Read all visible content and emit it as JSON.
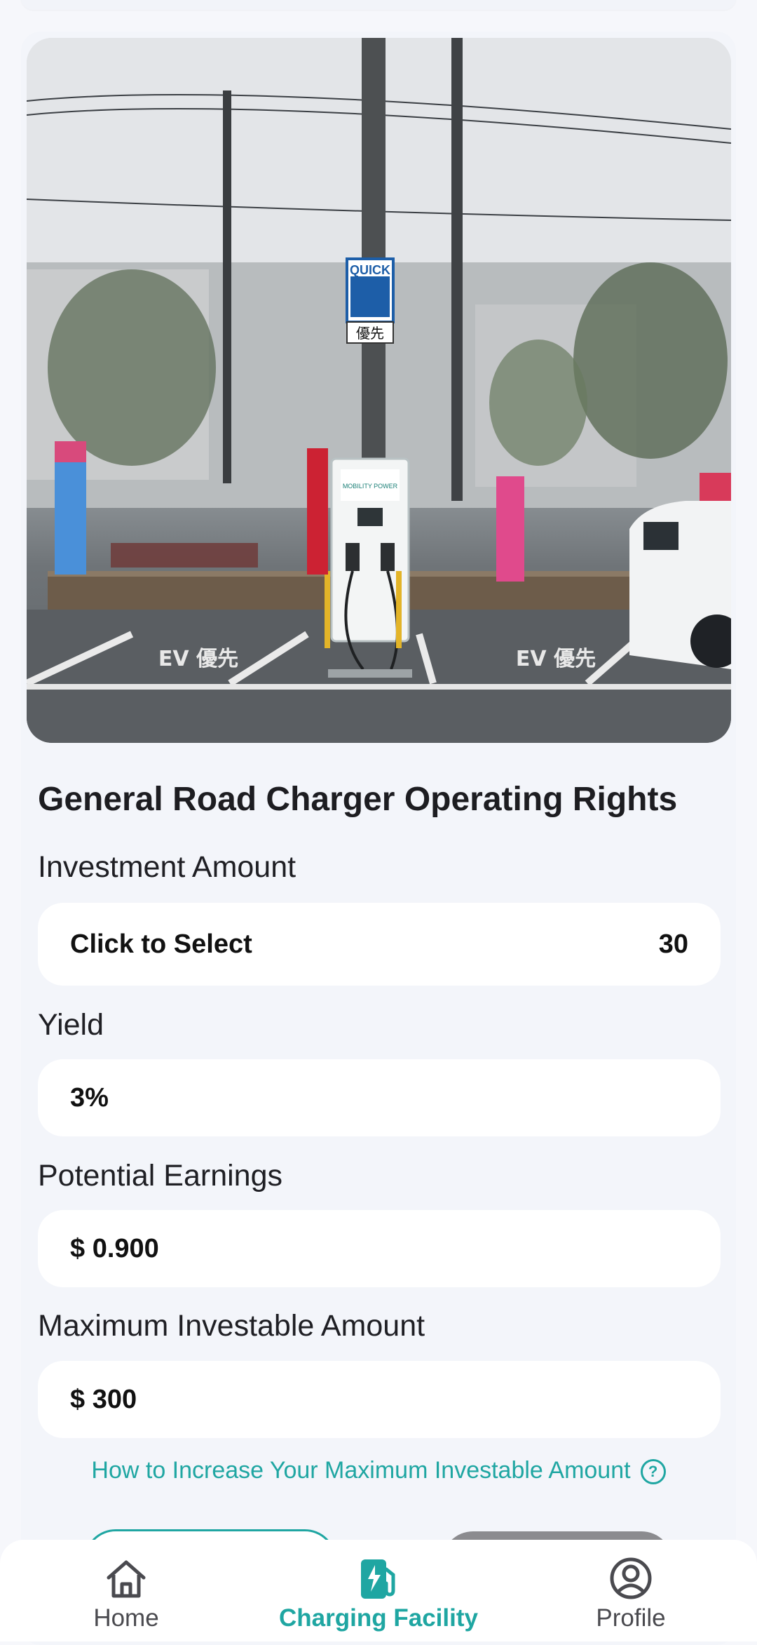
{
  "product": {
    "title": "General Road Charger Operating Rights"
  },
  "form": {
    "investment_amount_label": "Investment Amount",
    "investment_select_text": "Click to Select",
    "investment_value": "30",
    "yield_label": "Yield",
    "yield_value": "3%",
    "potential_earnings_label": "Potential Earnings",
    "potential_earnings_value": "$ 0.900",
    "max_investable_label": "Maximum Investable Amount",
    "max_investable_value": "$ 300"
  },
  "help": {
    "link_text": "How to Increase Your Maximum Investable Amount",
    "icon": "question-circle-icon"
  },
  "photo": {
    "sign_quick": "QUICK",
    "sign_priority": "優先",
    "charger_brand": "MOBILITY POWER",
    "road_marking_left": "EV 優先",
    "road_marking_right": "EV 優先"
  },
  "tabbar": {
    "items": [
      {
        "label": "Home",
        "icon": "home-icon"
      },
      {
        "label": "Charging Facility",
        "icon": "fuel-charger-icon",
        "active": true
      },
      {
        "label": "Profile",
        "icon": "user-circle-icon"
      }
    ]
  },
  "colors": {
    "accent": "#1fa6a2",
    "background": "#f6f7fb",
    "card": "#ffffff",
    "disabled_button": "#8b8b8f"
  }
}
